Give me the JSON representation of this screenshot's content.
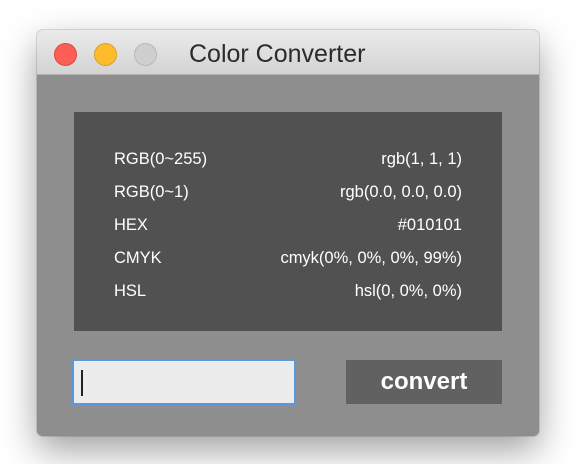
{
  "window": {
    "title": "Color Converter"
  },
  "results": {
    "rows": [
      {
        "label": "RGB(0~255)",
        "value": "rgb(1, 1, 1)"
      },
      {
        "label": "RGB(0~1)",
        "value": "rgb(0.0, 0.0, 0.0)"
      },
      {
        "label": "HEX",
        "value": "#010101"
      },
      {
        "label": "CMYK",
        "value": "cmyk(0%, 0%, 0%, 99%)"
      },
      {
        "label": "HSL",
        "value": "hsl(0, 0%, 0%)"
      }
    ]
  },
  "input": {
    "value": "",
    "placeholder": ""
  },
  "convert_button": {
    "label": "convert"
  },
  "colors": {
    "window_background": "#8e8e8e",
    "panel_background": "#515151",
    "button_background": "#616161",
    "input_focus_border": "#5c97dd",
    "close_button": "#fc5f57",
    "minimize_button": "#fdbc2e",
    "zoom_button": "#cfcfcf"
  },
  "icons": {
    "close": "close-traffic-light-icon",
    "minimize": "minimize-traffic-light-icon",
    "zoom": "zoom-traffic-light-icon"
  }
}
